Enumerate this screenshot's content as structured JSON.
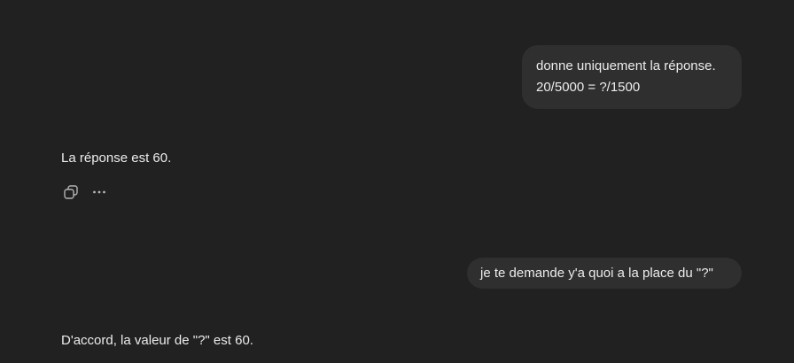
{
  "messages": [
    {
      "role": "user",
      "lines": [
        "donne uniquement la réponse.",
        "20/5000 = ?/1500"
      ]
    },
    {
      "role": "assistant",
      "text": "La réponse est 60."
    },
    {
      "role": "user",
      "text": "je te demande y'a quoi a la place du \"?\""
    },
    {
      "role": "assistant",
      "text": "D'accord, la valeur de \"?\" est 60."
    }
  ],
  "actions": {
    "copy_icon": "copy-icon",
    "more_icon": "more-options-icon"
  },
  "colors": {
    "background": "#212121",
    "user_bubble": "#2f2f2f",
    "text": "#ececec",
    "icon": "#b4b4b4"
  }
}
